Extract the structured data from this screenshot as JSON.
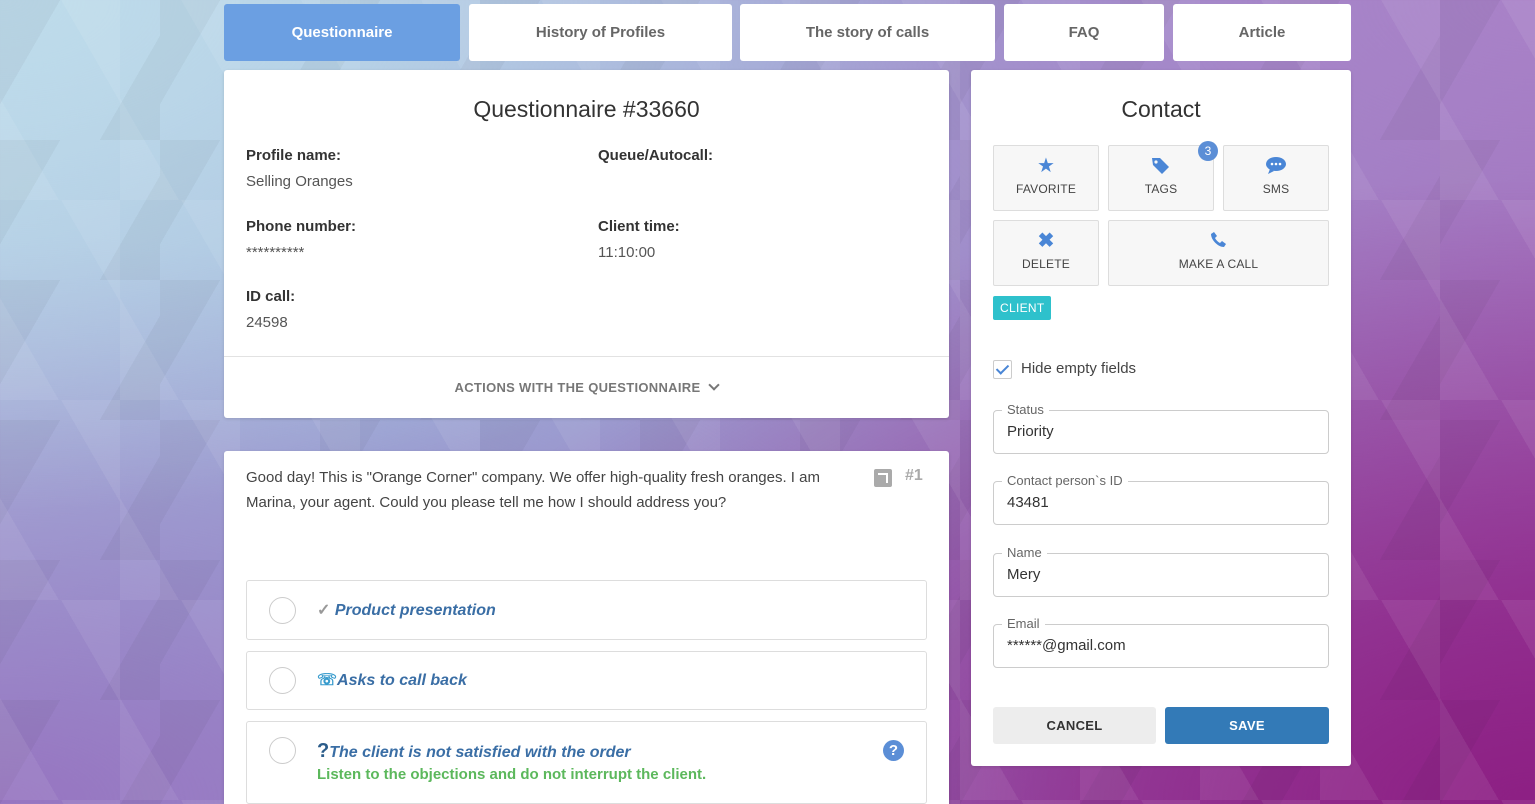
{
  "tabs": [
    {
      "label": "Questionnaire"
    },
    {
      "label": "History of Profiles"
    },
    {
      "label": "The story of calls"
    },
    {
      "label": "FAQ"
    },
    {
      "label": "Article"
    }
  ],
  "questionnaire": {
    "title": "Questionnaire #33660",
    "profile_name_label": "Profile name:",
    "profile_name": "Selling Oranges",
    "queue_label": "Queue/Autocall:",
    "queue": "",
    "phone_label": "Phone number:",
    "phone": "**********",
    "client_time_label": "Client time:",
    "client_time": "11:10:00",
    "id_call_label": "ID call:",
    "id_call": "24598",
    "actions_label": "ACTIONS WITH THE QUESTIONNAIRE"
  },
  "script": {
    "text": "Good day! This is \"Orange Corner\" company. We offer high-quality fresh oranges. I am Marina, your agent. Could you please tell me how I should address you?",
    "step_number": "#1",
    "options": [
      {
        "icon": "checkmark-icon",
        "label": "Product presentation"
      },
      {
        "icon": "phone-callback-icon",
        "label": "Asks to call back"
      },
      {
        "icon": "question-mark-icon",
        "label": "The client is not satisfied with the order",
        "hint": "Listen to the objections and do not interrupt the client."
      }
    ]
  },
  "contact": {
    "title": "Contact",
    "actions": {
      "favorite": "FAVORITE",
      "tags": "TAGS",
      "tags_count": "3",
      "sms": "SMS",
      "delete": "DELETE",
      "call": "MAKE A CALL"
    },
    "client_tag": "CLIENT",
    "hide_empty_label": "Hide empty fields",
    "hide_empty_checked": true,
    "fields": {
      "status_label": "Status",
      "status": "Priority",
      "person_id_label": "Contact person`s ID",
      "person_id": "43481",
      "name_label": "Name",
      "name": "Mery",
      "email_label": "Email",
      "email": "******@gmail.com"
    },
    "cancel_label": "CANCEL",
    "save_label": "SAVE"
  },
  "colors": {
    "accent": "#6b9fe2",
    "primary_button": "#337ab7",
    "client_tag": "#2ec1cc",
    "option_text": "#3a6ea5",
    "hint_text": "#5cb85c"
  }
}
